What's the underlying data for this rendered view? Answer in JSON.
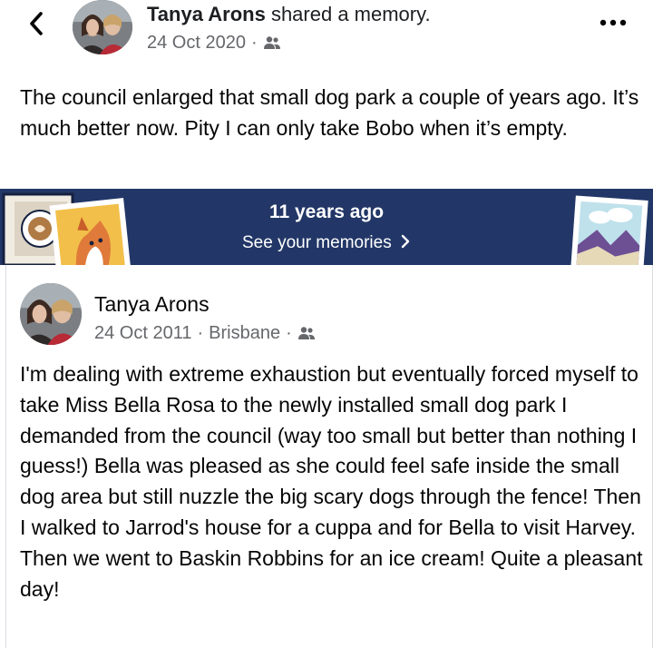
{
  "header": {
    "author": "Tanya Arons",
    "action": "shared a memory.",
    "date": "24 Oct 2020",
    "separator": "·"
  },
  "top_post": {
    "text": "The council enlarged that small dog park a couple of years ago.  It’s much better now.  Pity I can only take Bobo when it’s empty."
  },
  "memory_banner": {
    "title": "11 years ago",
    "link": "See your memories",
    "bg_color": "#223767"
  },
  "memory_post": {
    "author": "Tanya Arons",
    "date": "24 Oct 2011",
    "location": "Brisbane",
    "separator": "·",
    "text": "I'm dealing with extreme exhaustion but eventually forced myself to take Miss Bella Rosa to the newly installed small dog park I demanded from the council  (way too small but better than nothing I guess!)  Bella was pleased as she could feel safe inside the small dog area but still nuzzle the big scary dogs through the fence!  Then I walked to Jarrod's house for a cuppa and for Bella to visit Harvey.  Then we went to Baskin Robbins for an ice cream!  Quite a pleasant day!"
  },
  "icons": {
    "back": "chevron-left-icon",
    "more": "more-dots-icon",
    "audience": "friends-icon",
    "chevron": "chevron-right-icon"
  },
  "colors": {
    "meta_text": "#65676b",
    "body_text": "#050505"
  }
}
